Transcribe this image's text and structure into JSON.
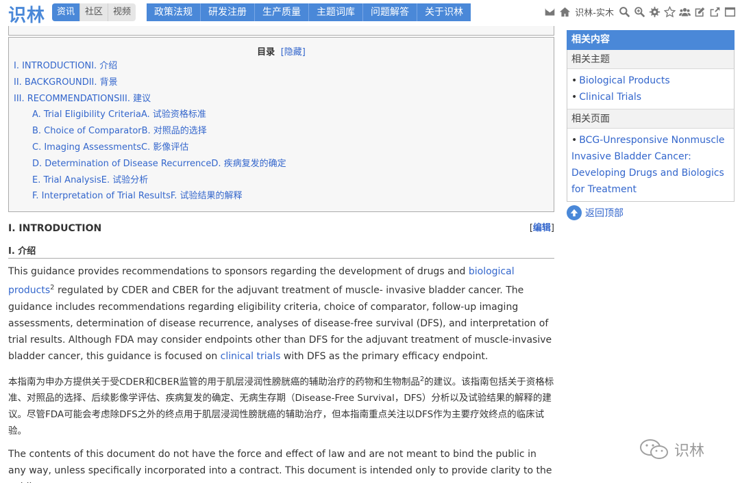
{
  "header": {
    "logo": "识林",
    "sub_tabs": [
      "资讯",
      "社区",
      "视频"
    ],
    "nav": [
      "政策法规",
      "研发注册",
      "生产质量",
      "主题词库",
      "问题解答",
      "关于识林"
    ],
    "user": "识林-实木"
  },
  "toc": {
    "title": "目录",
    "toggle_open": "[",
    "toggle_label": "隐藏",
    "toggle_close": "]",
    "items": [
      "I. INTRODUCTIONI. 介绍",
      "II. BACKGROUNDII. 背景",
      "III. RECOMMENDATIONSIII. 建议",
      "A. Trial Eligibility CriteriaA. 试验资格标准",
      "B. Choice of ComparatorB. 对照品的选择",
      "C. Imaging AssessmentsC. 影像评估",
      "D. Determination of Disease RecurrenceD. 疾病复发的确定",
      "E. Trial AnalysisE. 试验分析",
      "F. Interpretation of Trial ResultsF. 试验结果的解释"
    ]
  },
  "section": {
    "heading_en": "I. INTRODUCTION",
    "heading_cn": "I. 介绍",
    "edit_open": "[",
    "edit_label": "编辑",
    "edit_close": "]"
  },
  "para1": {
    "t1": "This guidance provides recommendations to sponsors regarding the development of drugs and ",
    "link1": "biological products",
    "sup1": "2",
    "t2": " regulated by CDER and CBER for the adjuvant treatment of muscle- invasive bladder cancer. The guidance includes recommendations regarding eligibility criteria, choice of comparator, follow-up imaging assessments, determination of disease recurrence, analyses of disease-free survival (DFS), and interpretation of trial results. Although FDA may consider endpoints other than DFS for the adjuvant treatment of muscle-invasive bladder cancer, this guidance is focused on ",
    "link2": "clinical trials",
    "t3": " with DFS as the primary efficacy endpoint."
  },
  "para2": {
    "t1": "本指南为申办方提供关于受CDER和CBER监管的用于肌层浸润性膀胱癌的辅助治疗的药物和生物制品",
    "sup": "2",
    "t2": "的建议。该指南包括关于资格标准、对照品的选择、后续影像学评估、疾病复发的确定、无病生存期（Disease-Free Survival，DFS）分析以及试验结果的解释的建议。尽管FDA可能会考虑除DFS之外的终点用于肌层浸润性膀胱癌的辅助治疗，但本指南重点关注以DFS作为主要疗效终点的临床试验。"
  },
  "para3": {
    "text": "The contents of this document do not have the force and effect of law and are not meant to bind the public in any way, unless specifically incorporated into a contract. This document is intended only to provide clarity to the public"
  },
  "sidebar": {
    "header": "相关内容",
    "topics_label": "相关主题",
    "topics": [
      "Biological Products",
      "Clinical Trials"
    ],
    "bullet": "•",
    "pages_label": "相关页面",
    "pages": [
      "BCG-Unresponsive Nonmuscle Invasive Bladder Cancer: Developing Drugs and Biologics for Treatment"
    ],
    "back_to_top": "返回顶部"
  },
  "watermark": "识林",
  "colors": {
    "accent": "#4a88d8",
    "link": "#3366cc"
  }
}
